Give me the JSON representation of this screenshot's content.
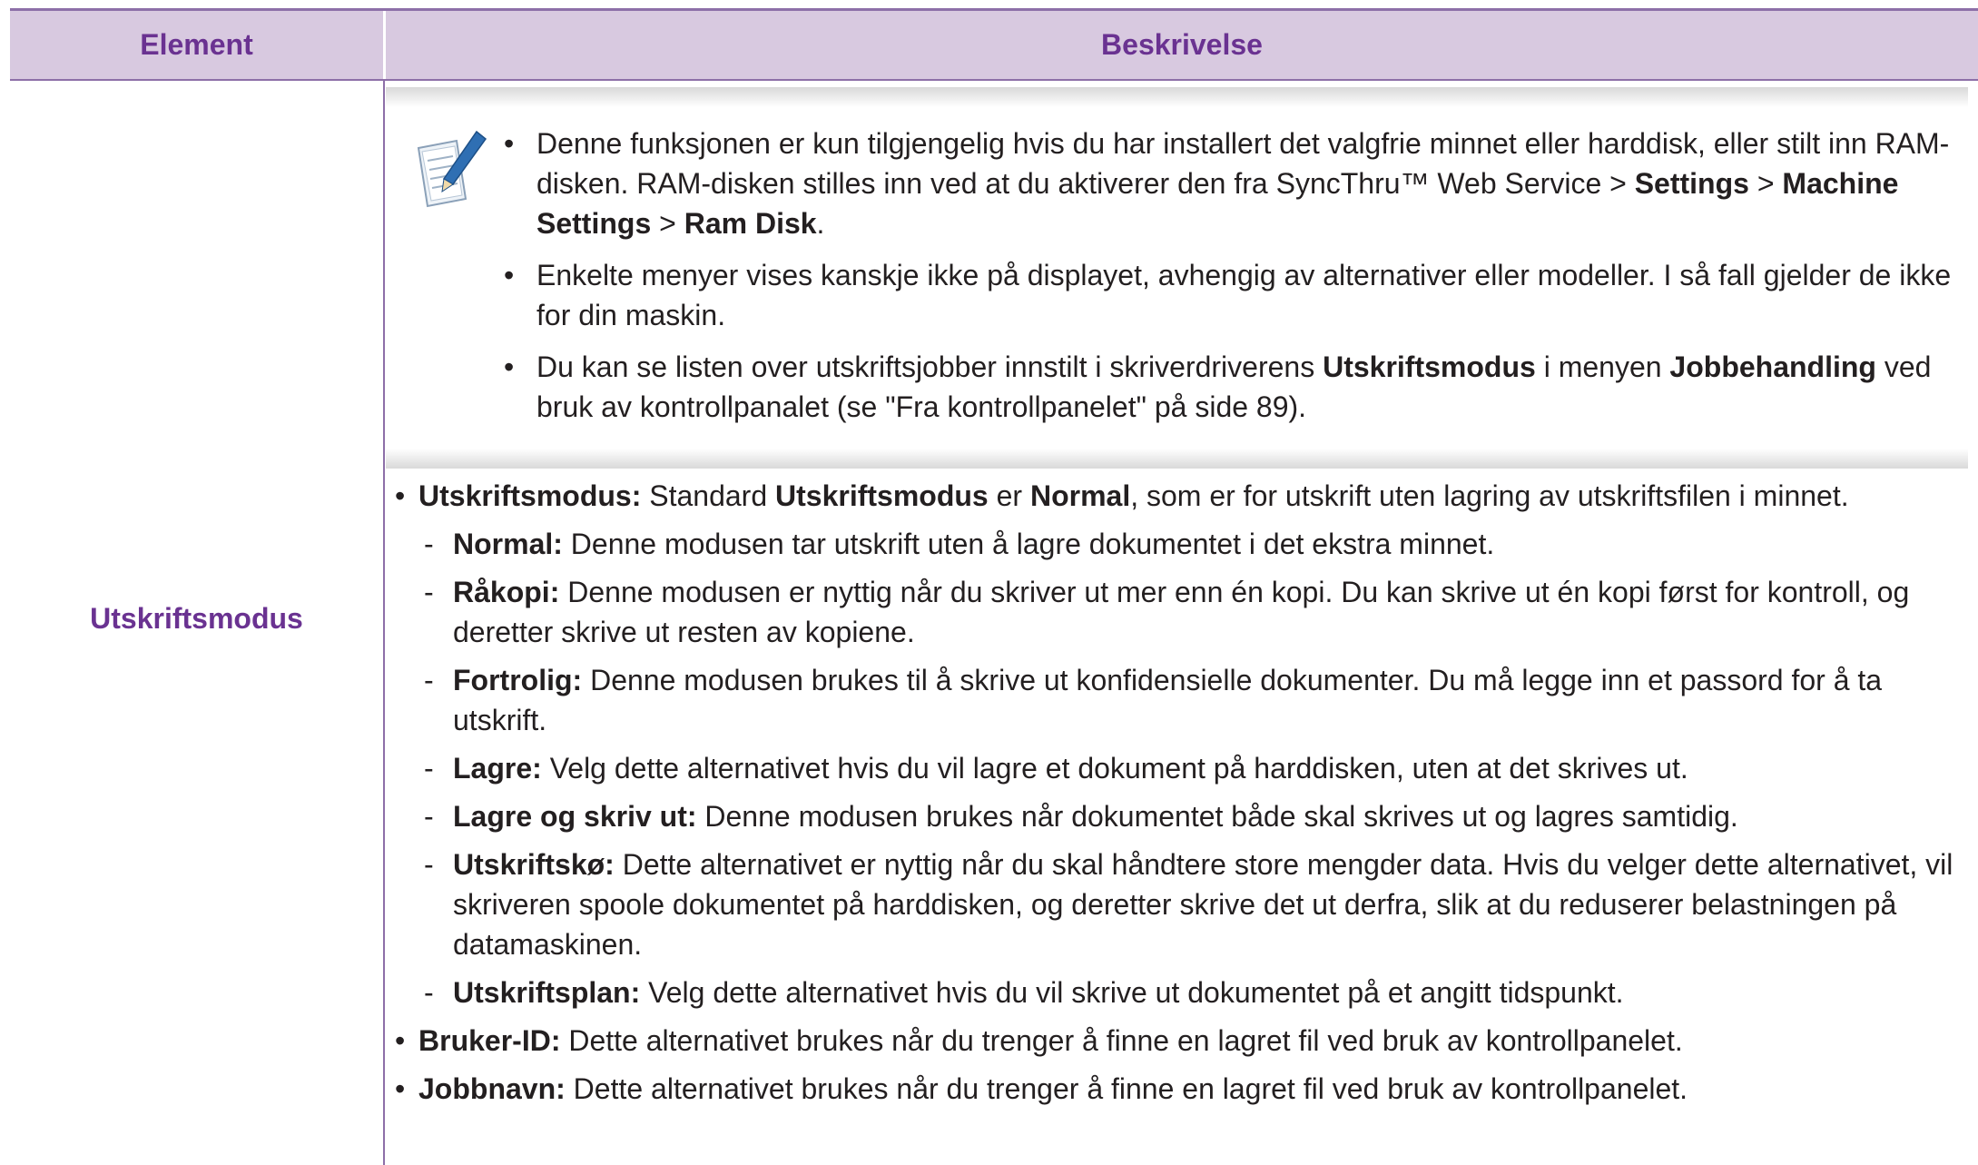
{
  "table": {
    "header": {
      "element": "Element",
      "description": "Beskrivelse"
    },
    "row": {
      "element": "Utskriftsmodus"
    }
  },
  "note": {
    "icon": "note-pencil-icon",
    "bullet": "•",
    "items": [
      {
        "t1": "Denne funksjonen er kun tilgjengelig hvis du har installert det valgfrie minnet eller harddisk, eller stilt inn RAM-disken. RAM-disken stilles inn ved at du aktiverer den fra SyncThru™ Web Service > ",
        "b1": "Settings",
        "t2": " > ",
        "b2": "Machine Settings",
        "t3": " > ",
        "b3": "Ram Disk",
        "t4": "."
      },
      {
        "t1": "Enkelte menyer vises kanskje ikke på displayet, avhengig av alternativer eller modeller. I så fall gjelder de ikke for din maskin."
      },
      {
        "t1": "Du kan se listen over utskriftsjobber innstilt i skriverdriverens ",
        "b1": "Utskriftsmodus",
        "t2": " i menyen ",
        "b2": "Jobbehandling",
        "t3": " ved bruk av kontrollpanalet (se \"Fra kontrollpanelet\" på side 89)."
      }
    ]
  },
  "main": {
    "bullet": "•",
    "dash": "-",
    "mode": {
      "label": "Utskriftsmodus:",
      "t1": " Standard ",
      "b1": "Utskriftsmodus",
      "t2": " er ",
      "b2": "Normal",
      "t3": ", som er for utskrift uten lagring av utskriftsfilen i minnet."
    },
    "modes": [
      {
        "label": "Normal:",
        "text": " Denne modusen tar utskrift uten å lagre dokumentet i det ekstra minnet."
      },
      {
        "label": "Råkopi:",
        "text": " Denne modusen er nyttig når du skriver ut mer enn én kopi. Du kan skrive ut én kopi først for kontroll, og deretter skrive ut resten av kopiene."
      },
      {
        "label": "Fortrolig:",
        "text": " Denne modusen brukes til å skrive ut konfidensielle dokumenter. Du må legge inn et passord for å ta utskrift."
      },
      {
        "label": "Lagre:",
        "text": " Velg dette alternativet hvis du vil lagre et dokument på harddisken, uten at det skrives ut."
      },
      {
        "label": "Lagre og skriv ut:",
        "text": " Denne modusen brukes når dokumentet både skal skrives ut og lagres samtidig."
      },
      {
        "label": "Utskriftskø:",
        "text": " Dette alternativet er nyttig når du skal håndtere store mengder data. Hvis du velger dette alternativet, vil skriveren spoole dokumentet på harddisken, og deretter skrive det ut derfra, slik at du reduserer belastningen på datamaskinen."
      },
      {
        "label": "Utskriftsplan:",
        "text": " Velg dette alternativet hvis du vil skrive ut dokumentet på et angitt tidspunkt."
      }
    ],
    "user_id": {
      "label": "Bruker-ID:",
      "text": " Dette alternativet brukes når du trenger å finne en lagret fil ved bruk av kontrollpanelet."
    },
    "job_name": {
      "label": "Jobbnavn:",
      "text": " Dette alternativet brukes når du trenger å finne en lagret fil ved bruk av kontrollpanelet."
    }
  },
  "colors": {
    "header_bg": "#d8c9e0",
    "header_text": "#6a3291",
    "rule": "#8d6fa8",
    "body_text": "#231f20"
  }
}
